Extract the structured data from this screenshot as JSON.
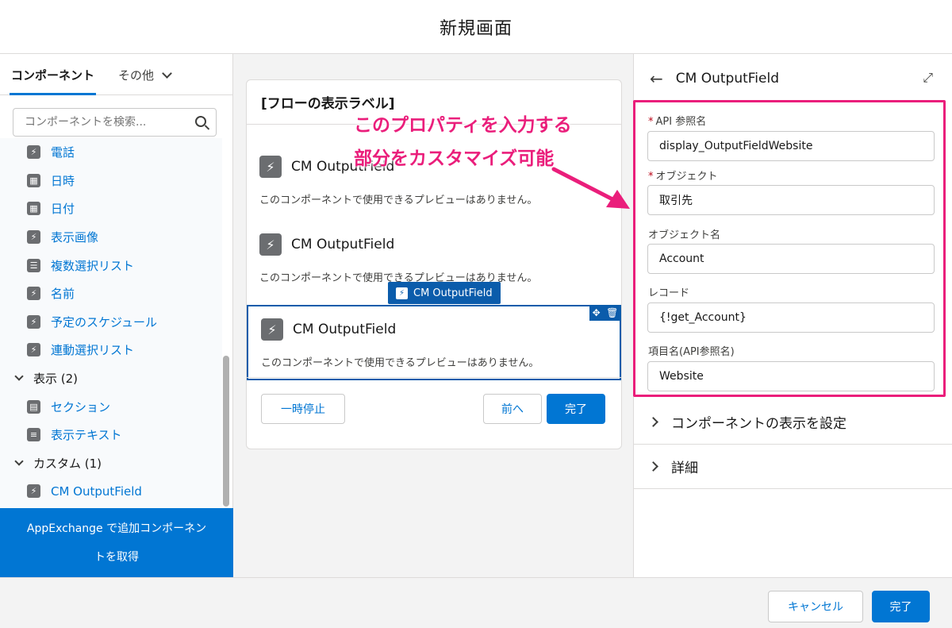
{
  "header": {
    "title": "新規画面"
  },
  "left_panel": {
    "tabs": [
      {
        "label": "コンポーネント"
      },
      {
        "label": "その他"
      }
    ],
    "search_placeholder": "コンポーネントを検索...",
    "items": [
      {
        "label": "電話",
        "icon": "lightning-icon"
      },
      {
        "label": "日時",
        "icon": "calendar-icon"
      },
      {
        "label": "日付",
        "icon": "calendar-icon"
      },
      {
        "label": "表示画像",
        "icon": "lightning-icon"
      },
      {
        "label": "複数選択リスト",
        "icon": "picklist-icon"
      },
      {
        "label": "名前",
        "icon": "lightning-icon"
      },
      {
        "label": "予定のスケジュール",
        "icon": "lightning-icon"
      },
      {
        "label": "連動選択リスト",
        "icon": "lightning-icon"
      }
    ],
    "groups": [
      {
        "label": "表示 (2)",
        "items": [
          {
            "label": "セクション",
            "icon": "section-icon"
          },
          {
            "label": "表示テキスト",
            "icon": "text-icon"
          }
        ]
      },
      {
        "label": "カスタム (1)",
        "items": [
          {
            "label": "CM OutputField",
            "icon": "lightning-icon"
          }
        ]
      }
    ],
    "appexchange_line1": "AppExchange で追加コンポーネン",
    "appexchange_line2": "トを取得"
  },
  "canvas": {
    "card_title": "[フローの表示ラベル]",
    "components": [
      {
        "name": "CM OutputField",
        "desc": "このコンポーネントで使用できるプレビューはありません。"
      },
      {
        "name": "CM OutputField",
        "desc": "このコンポーネントで使用できるプレビューはありません。"
      },
      {
        "name": "CM OutputField",
        "desc": "このコンポーネントで使用できるプレビューはありません。"
      }
    ],
    "selected_tag": "CM OutputField",
    "pause_button": "一時停止",
    "prev_button": "前へ",
    "finish_button": "完了"
  },
  "right_panel": {
    "title": "CM OutputField",
    "fields": [
      {
        "label": "API 参照名",
        "required": "*",
        "value": "display_OutputFieldWebsite"
      },
      {
        "label": "オブジェクト",
        "required": "*",
        "value": "取引先"
      },
      {
        "label": "オブジェクト名",
        "required": "",
        "value": "Account"
      },
      {
        "label": "レコード",
        "required": "",
        "value": "{!get_Account}"
      },
      {
        "label": "項目名(API参照名)",
        "required": "",
        "value": "Website"
      }
    ],
    "sections": [
      {
        "label": "コンポーネントの表示を設定"
      },
      {
        "label": "詳細"
      }
    ]
  },
  "annotation": {
    "line1": "このプロパティを入力する",
    "line2": "部分をカスタマイズ可能"
  },
  "footer": {
    "cancel_button": "キャンセル",
    "done_button": "完了"
  },
  "colors": {
    "brand": "#0176d3",
    "highlight": "#ea1e7b"
  }
}
